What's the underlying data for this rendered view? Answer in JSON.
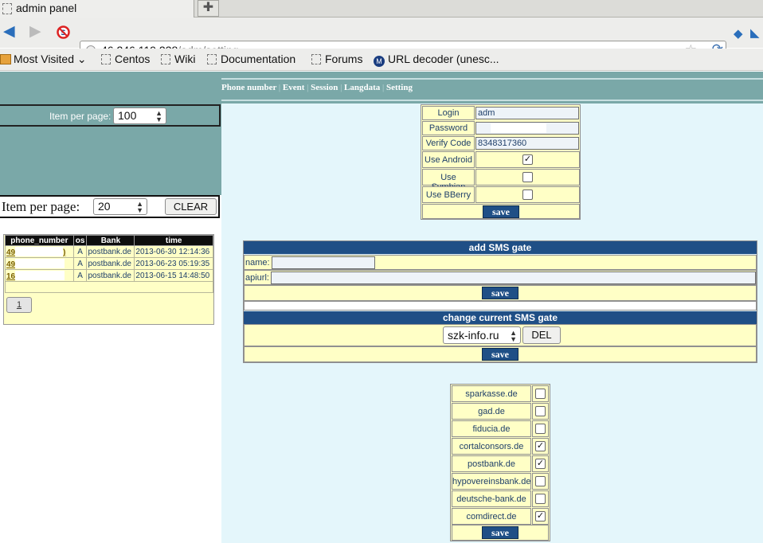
{
  "browser": {
    "tab_title": "admin panel",
    "new_tab": "✚",
    "url_host": "46.246.119.238",
    "url_path": "/adm/setting",
    "bookmarks": [
      "Most Visited",
      "Centos",
      "Wiki",
      "Documentation",
      "Forums",
      "URL decoder (unesc..."
    ]
  },
  "nav": {
    "links": [
      "Phone number",
      "Event",
      "Session",
      "Langdata",
      "Setting"
    ]
  },
  "left": {
    "item_per_page_label_1": "Item per page:",
    "item_per_page_value_1": "100",
    "item_per_page_label_2": "Item per page:",
    "item_per_page_value_2": "20",
    "clear_button": "CLEAR",
    "table": {
      "headers": [
        "phone_number",
        "os",
        "Bank",
        "time"
      ],
      "rows": [
        {
          "phone": "49",
          "os": "A",
          "bank": "postbank.de",
          "time": "2013-06-30 12:14:36"
        },
        {
          "phone": "49",
          "os": "A",
          "bank": "postbank.de",
          "time": "2013-06-23 05:19:35"
        },
        {
          "phone": "16",
          "os": "A",
          "bank": "postbank.de",
          "time": "2013-06-15 14:48:50"
        }
      ]
    },
    "page_number": "1"
  },
  "settings": {
    "login_label": "Login",
    "login_value": "adm",
    "password_label": "Password",
    "verify_label": "Verify Code",
    "verify_value": "8348317360",
    "android_label": "Use Android",
    "android_checked": true,
    "symbian_label": "Use Symbian",
    "symbian_checked": false,
    "bberry_label": "Use BBerry",
    "bberry_checked": false,
    "save": "save"
  },
  "sms_gate": {
    "add_title": "add SMS gate",
    "name_label": "name:",
    "apiurl_label": "apiurl:",
    "save": "save",
    "change_title": "change current SMS gate",
    "current": "szk-info.ru",
    "del": "DEL",
    "save2": "save"
  },
  "banks": {
    "items": [
      {
        "name": "sparkasse.de",
        "checked": false
      },
      {
        "name": "gad.de",
        "checked": false
      },
      {
        "name": "fiducia.de",
        "checked": false
      },
      {
        "name": "cortalconsors.de",
        "checked": true
      },
      {
        "name": "postbank.de",
        "checked": true
      },
      {
        "name": "hypovereinsbank.de",
        "checked": false
      },
      {
        "name": "deutsche-bank.de",
        "checked": false
      },
      {
        "name": "comdirect.de",
        "checked": true
      }
    ],
    "save": "save"
  },
  "icons": {
    "checkmark": "✓"
  }
}
